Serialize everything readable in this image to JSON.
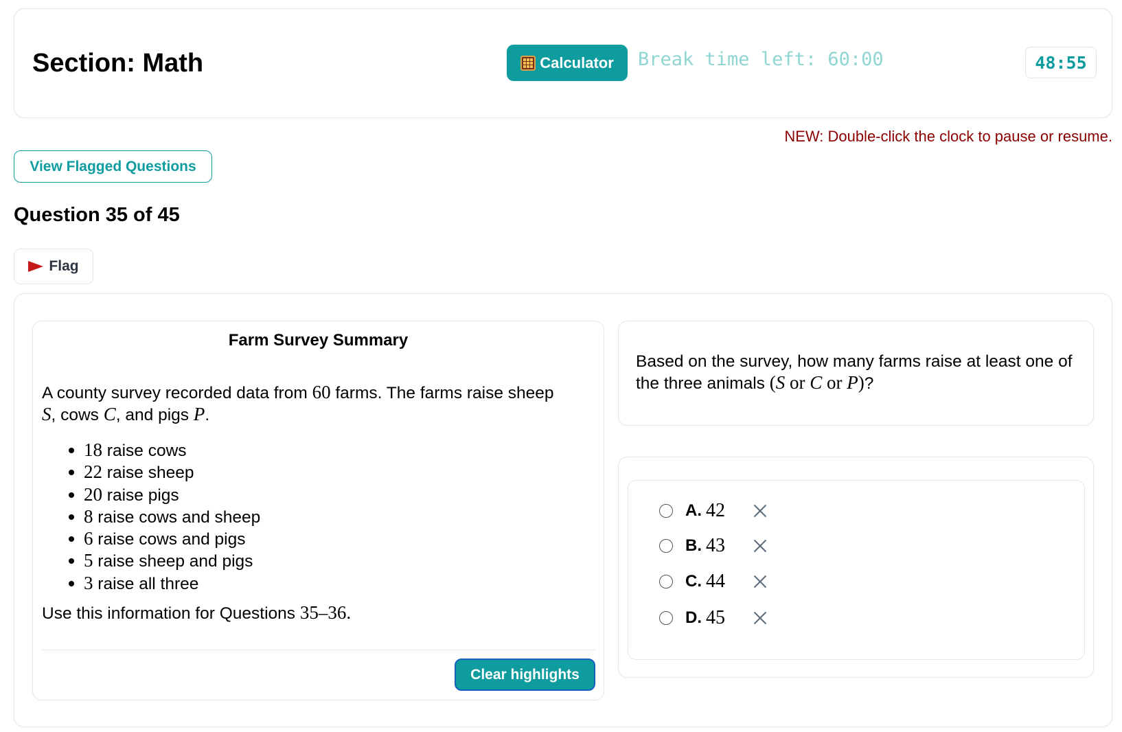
{
  "header": {
    "section_title": "Section: Math",
    "calculator_label": "Calculator",
    "break_time": "Break time left: 60:00",
    "clock": "48:55"
  },
  "notice": "NEW: Double-click the clock to pause or resume.",
  "view_flagged_label": "View Flagged Questions",
  "question_number": "Question 35 of 45",
  "flag_label": "Flag",
  "passage": {
    "title": "Farm Survey Summary",
    "intro_pre": "A county survey recorded data from ",
    "total_farms": "60",
    "intro_mid": " farms. The farms raise sheep ",
    "var_s": "S",
    "cows_text": ", cows ",
    "var_c": "C",
    "pigs_text": ", and pigs ",
    "var_p": "P",
    "end_dot": ".",
    "facts": [
      {
        "num": "18",
        "text": " raise cows"
      },
      {
        "num": "22",
        "text": " raise sheep"
      },
      {
        "num": "20",
        "text": " raise pigs"
      },
      {
        "num": "8",
        "text": " raise cows and sheep"
      },
      {
        "num": "6",
        "text": " raise cows and pigs"
      },
      {
        "num": "5",
        "text": " raise sheep and pigs"
      },
      {
        "num": "3",
        "text": " raise all three"
      }
    ],
    "footer_pre": "Use this information for Questions ",
    "footer_range": "35–36.",
    "clear_highlights": "Clear highlights"
  },
  "question": {
    "text_pre": "Based on the survey, how many farms raise at least one of the three animals ",
    "math_open": "(",
    "s": "S",
    "or1": " or ",
    "c": "C",
    "or2": " or ",
    "p": "P",
    "math_close": ")",
    "qmark": "?"
  },
  "choices": [
    {
      "letter": "A.",
      "value": "42"
    },
    {
      "letter": "B.",
      "value": "43"
    },
    {
      "letter": "C.",
      "value": "44"
    },
    {
      "letter": "D.",
      "value": "45"
    }
  ],
  "colors": {
    "accent": "#0f9c9f",
    "notice": "#8b0000",
    "flag": "#c61a1a"
  }
}
